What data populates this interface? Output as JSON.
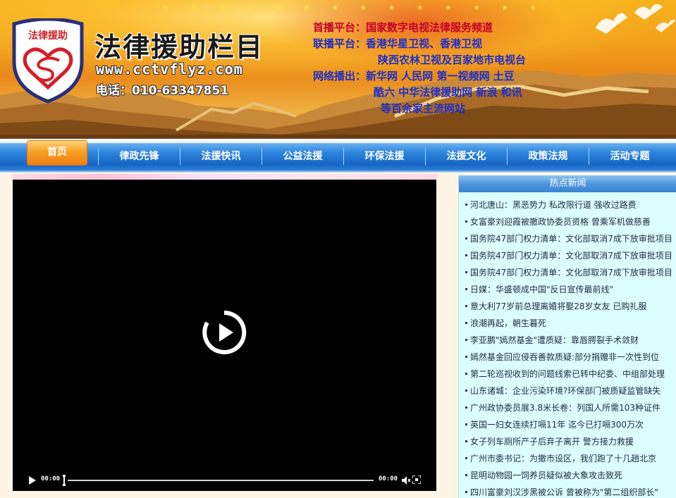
{
  "banner": {
    "logo_text": "法律援助",
    "title": "法律援助栏目",
    "url": "www.cctvflyz.com",
    "phone": "电话：010-63347851",
    "platforms": [
      {
        "label": "首播平台：",
        "value": "国家数字电视法律服务频道"
      },
      {
        "label": "联播平台：",
        "value": "香港华星卫视、香港卫视"
      },
      {
        "label": "",
        "value": "陕西农林卫视及百家地市电视台"
      },
      {
        "label": "网络播出：",
        "value": "新华网 人民网 第一视频网 土豆"
      },
      {
        "label": "",
        "value": "酷六  中华法律援助网  新浪 和讯"
      },
      {
        "label": "",
        "value": "等百余家主流网站"
      }
    ]
  },
  "nav": {
    "home": "首页",
    "items": [
      "律政先锋",
      "法援快讯",
      "公益法援",
      "环保法援",
      "法援文化",
      "政策法规",
      "活动专题"
    ]
  },
  "player": {
    "time_current": "00:00",
    "time_total": "00:00"
  },
  "hot_news": {
    "title": "热点新闻",
    "items": [
      "河北唐山：黑恶势力 私改限行道 强收过路费",
      "女富豪刘迎霞被撤政协委员资格 曾乘军机做慈善",
      "国务院47部门权力清单：文化部取消7成下放审批项目",
      "国务院47部门权力清单：文化部取消7成下放审批项目",
      "国务院47部门权力清单：文化部取消7成下放审批项目",
      "日媒：华盛顿成中国\"反日宣传最前线\"",
      "意大利77岁前总理离婚将娶28岁女友 已购礼服",
      "浪潮再起，朝生暮死",
      "李亚鹏\"嫣然基金\"遭质疑：靠唇腭裂手术敛财",
      "嫣然基金回应侵吞善款质疑:部分捐赠非一次性到位",
      "第二轮巡视收到的问题线索已转中纪委、中组部处理",
      "山东诸城：企业污染环境?环保部门被质疑监管缺失",
      "广州政协委员展3.8米长卷：列国人所需103种证件",
      "英国一妇女连续打嗝11年 迄今已打嗝300万次",
      "女子列车厕所产子后弃子离开 警方接力救援",
      "广州市委书记：为撤市设区，我们跑了十几趟北京",
      "昆明动物园一饲养员疑似被大象攻击致死",
      "四川富豪刘汉涉黑被公诉 曾被称为\"第二组织部长\""
    ]
  },
  "colors": {
    "nav_blue": "#1765c4",
    "home_orange": "#ef7d10",
    "news_bg": "#dcfdfd",
    "platform_red": "#c3002a",
    "platform_blue": "#1d2ec8"
  }
}
